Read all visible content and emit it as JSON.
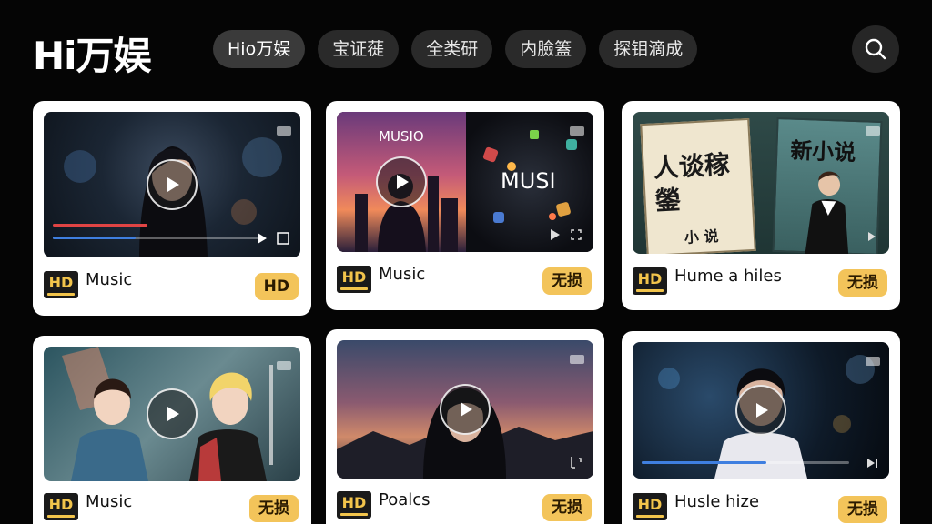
{
  "header": {
    "logo": "Hi万娱",
    "tabs": [
      {
        "label": "Hio万娱"
      },
      {
        "label": "宝证蓰"
      },
      {
        "label": "全类研"
      },
      {
        "label": "内臉篕"
      },
      {
        "label": "探钼滴成"
      }
    ],
    "search_icon": "search-icon"
  },
  "cards": [
    {
      "title": "Music",
      "badge": "HD",
      "logo": "HD",
      "progress": 0.4
    },
    {
      "title": "Music",
      "badge": "无损",
      "logo": "HD",
      "poster_left": "MUSIO",
      "poster_right": "MUSI"
    },
    {
      "title": "Hume a hiles",
      "badge": "无损",
      "logo": "HD",
      "book_left": "人谈稼\n鎣",
      "book_left_bottom": "小 说",
      "book_right": "新小说"
    },
    {
      "title": "Music",
      "badge": "无损",
      "logo": "HD"
    },
    {
      "title": "Poalcs",
      "badge": "无损",
      "logo": "HD"
    },
    {
      "title": "Husle hize",
      "badge": "无损",
      "logo": "HD",
      "progress": 0.6
    }
  ],
  "colors": {
    "accent": "#f3c45a",
    "background": "#050505",
    "card": "#ffffff",
    "progress": "#3f7fe0"
  }
}
